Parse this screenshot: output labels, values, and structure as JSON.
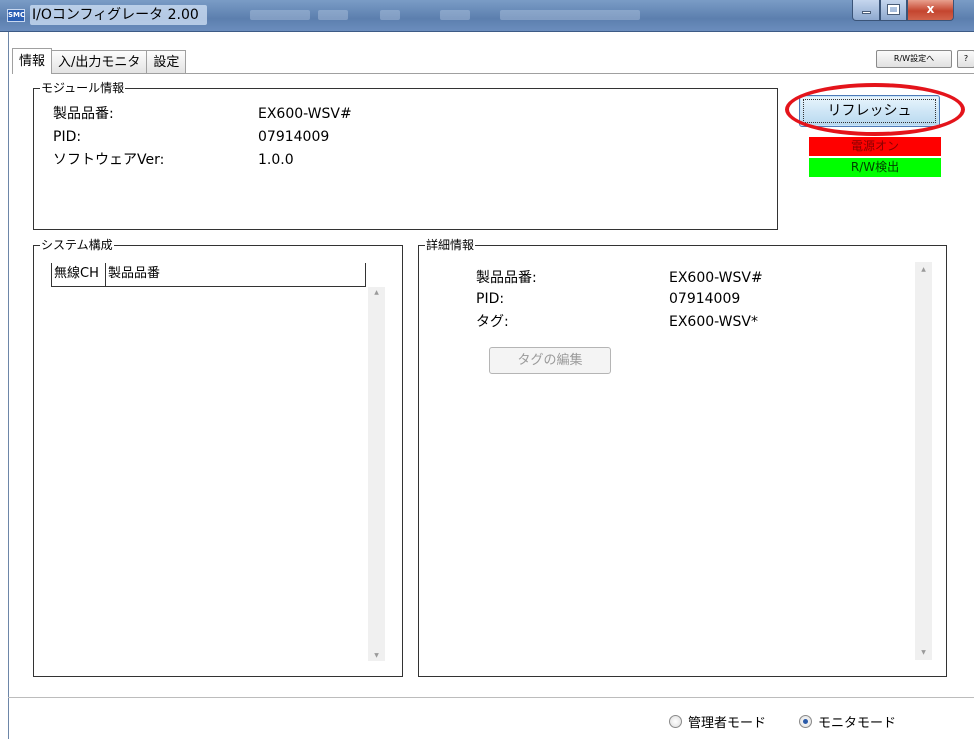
{
  "window": {
    "app_icon_text": "SMC",
    "title": "I/Oコンフィグレータ 2.00",
    "min_label": "",
    "max_label": "",
    "close_label": "x"
  },
  "tabs": [
    {
      "label": "情報",
      "active": true
    },
    {
      "label": "入/出力モニタ",
      "active": false
    },
    {
      "label": "設定",
      "active": false
    }
  ],
  "toolbar": {
    "rw_settings_label": "R/W設定へ",
    "help_label": "?"
  },
  "module_info": {
    "title": "モジュール情報",
    "rows": [
      {
        "label": "製品品番:",
        "value": "EX600-WSV#"
      },
      {
        "label": "PID:",
        "value": "07914009"
      },
      {
        "label": "ソフトウェアVer:",
        "value": "1.0.0"
      }
    ]
  },
  "actions": {
    "refresh_label": "リフレッシュ"
  },
  "status": {
    "power_label": "電源オン",
    "power_color": "#ff0000",
    "rw_label": "R/W検出",
    "rw_color": "#00ff00"
  },
  "system_config": {
    "title": "システム構成",
    "columns": [
      "無線CH",
      "製品品番"
    ]
  },
  "details": {
    "title": "詳細情報",
    "rows": [
      {
        "label": "製品品番:",
        "value": "EX600-WSV#"
      },
      {
        "label": "PID:",
        "value": "07914009"
      },
      {
        "label": "タグ:",
        "value": "EX600-WSV*"
      }
    ],
    "edit_tag_label": "タグの編集"
  },
  "mode": {
    "admin_label": "管理者モード",
    "monitor_label": "モニタモード",
    "selected": "monitor"
  }
}
